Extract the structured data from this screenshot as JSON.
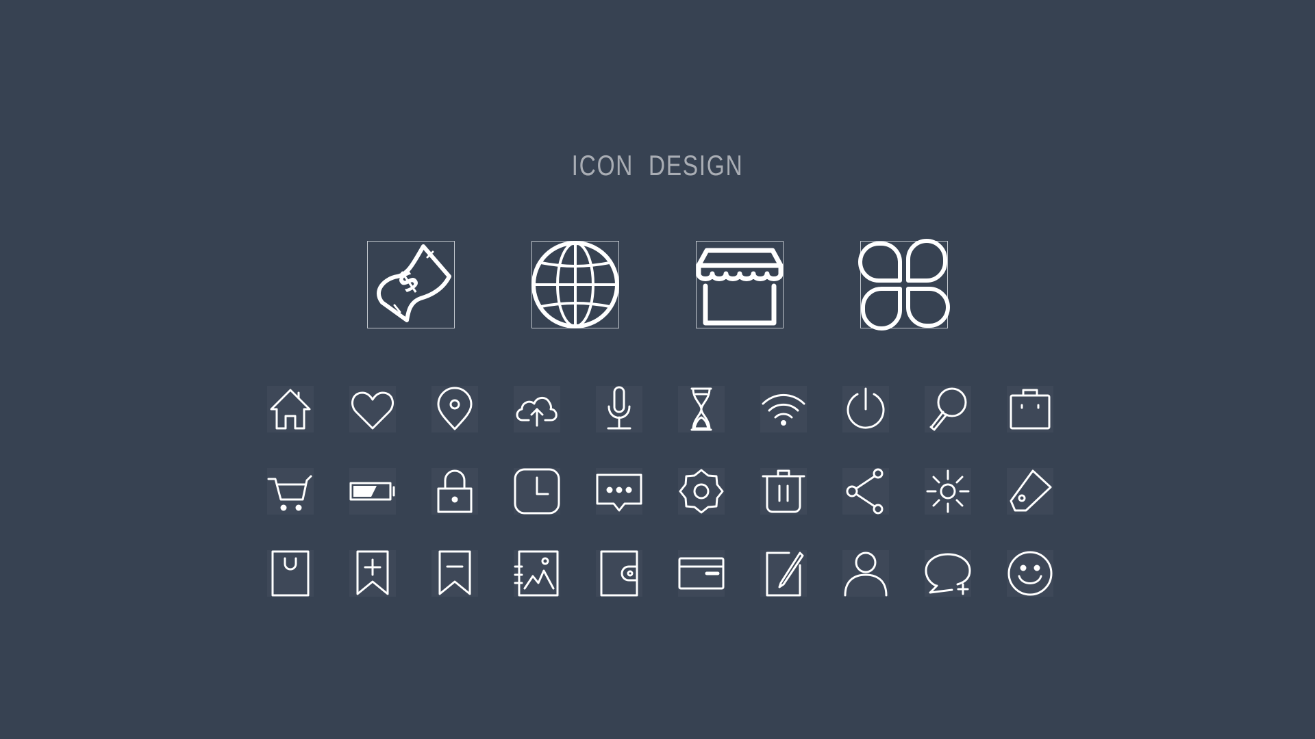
{
  "title": "ICON  DESIGN",
  "colors": {
    "background": "#374252",
    "icon_stroke": "#ffffff",
    "title": "#a9adb4",
    "tile": "#3e4858",
    "frame": "#c3c8cf"
  },
  "featured_icons": [
    "money-icon",
    "globe-icon",
    "store-icon",
    "clover-icon"
  ],
  "icon_rows": [
    [
      "home-icon",
      "heart-icon",
      "location-pin-icon",
      "cloud-upload-icon",
      "microphone-icon",
      "hourglass-icon",
      "wifi-icon",
      "power-icon",
      "magnifier-icon",
      "briefcase-icon"
    ],
    [
      "cart-icon",
      "battery-icon",
      "lock-icon",
      "clock-icon",
      "message-icon",
      "settings-icon",
      "trash-icon",
      "share-icon",
      "brightness-icon",
      "tag-icon"
    ],
    [
      "shopping-bag-icon",
      "bookmark-add-icon",
      "bookmark-remove-icon",
      "gallery-icon",
      "wallet-icon",
      "credit-card-icon",
      "edit-icon",
      "user-icon",
      "chat-add-icon",
      "smile-icon"
    ]
  ]
}
